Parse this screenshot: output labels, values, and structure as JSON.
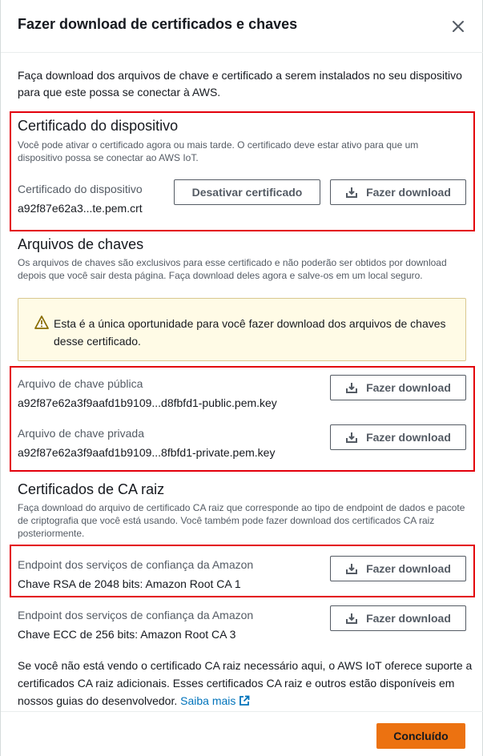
{
  "modal": {
    "title": "Fazer download de certificados e chaves",
    "intro": "Faça download dos arquivos de chave e certificado a serem instalados no seu dispositivo para que este possa se conectar à AWS."
  },
  "device_cert": {
    "title": "Certificado do dispositivo",
    "description": "Você pode ativar o certificado agora ou mais tarde. O certificado deve estar ativo para que um dispositivo possa se conectar ao AWS IoT.",
    "label": "Certificado do dispositivo",
    "value": "a92f87e62a3...te.pem.crt",
    "deactivate_label": "Desativar certificado",
    "download_label": "Fazer download"
  },
  "key_files": {
    "title": "Arquivos de chaves",
    "description": "Os arquivos de chaves são exclusivos para esse certificado e não poderão ser obtidos por download depois que você sair desta página. Faça download deles agora e salve-os em um local seguro.",
    "warning": "Esta é a única oportunidade para você fazer download dos arquivos de chaves desse certificado.",
    "public_label": "Arquivo de chave pública",
    "public_value": "a92f87e62a3f9aafd1b9109...d8fbfd1-public.pem.key",
    "public_download": "Fazer download",
    "private_label": "Arquivo de chave privada",
    "private_value": "a92f87e62a3f9aafd1b9109...8fbfd1-private.pem.key",
    "private_download": "Fazer download"
  },
  "ca_certs": {
    "title": "Certificados de CA raiz",
    "description": "Faça download do arquivo de certificado CA raiz que corresponde ao tipo de endpoint de dados e pacote de criptografia que você está usando. Você também pode fazer download dos certificados CA raiz posteriormente.",
    "rsa_label": "Endpoint dos serviços de confiança da Amazon",
    "rsa_value": "Chave RSA de 2048 bits: Amazon Root CA 1",
    "rsa_download": "Fazer download",
    "ecc_label": "Endpoint dos serviços de confiança da Amazon",
    "ecc_value": "Chave ECC de 256 bits: Amazon Root CA 3",
    "ecc_download": "Fazer download"
  },
  "footer": {
    "note": "Se você não está vendo o certificado CA raiz necessário aqui, o AWS IoT oferece suporte a certificados CA raiz adicionais. Esses certificados CA raiz e outros estão disponíveis em nossos guias do desenvolvedor.",
    "link": "Saiba mais",
    "done": "Concluído"
  },
  "icons": {
    "close": "close-icon",
    "download": "download-icon",
    "warning": "warning-icon",
    "external": "external-link-icon"
  },
  "colors": {
    "highlight": "#e3000b",
    "primary": "#ec7211",
    "link": "#0073bb",
    "warning_bg": "#fffbe6"
  }
}
